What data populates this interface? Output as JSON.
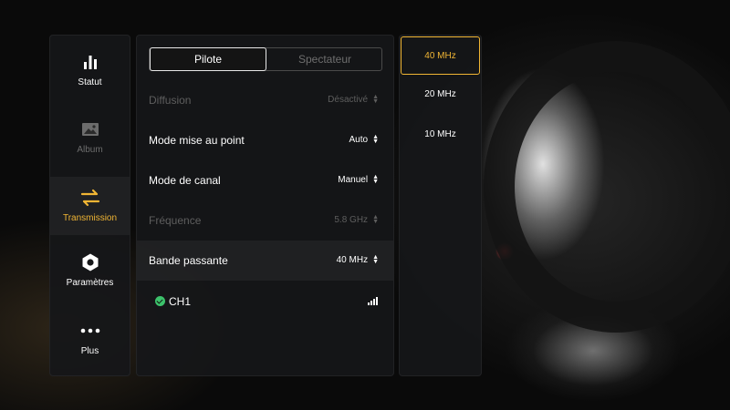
{
  "sidebar": {
    "items": [
      {
        "label": "Statut",
        "icon": "bar-chart-icon",
        "state": "normal"
      },
      {
        "label": "Album",
        "icon": "image-icon",
        "state": "disabled"
      },
      {
        "label": "Transmission",
        "icon": "transfer-arrows-icon",
        "state": "active"
      },
      {
        "label": "Paramètres",
        "icon": "hexagon-settings-icon",
        "state": "normal"
      },
      {
        "label": "Plus",
        "icon": "more-dots-icon",
        "state": "normal"
      }
    ]
  },
  "main": {
    "tabs": [
      {
        "label": "Pilote",
        "selected": true
      },
      {
        "label": "Spectateur",
        "selected": false
      }
    ],
    "rows": [
      {
        "label": "Diffusion",
        "value": "Désactivé",
        "enabled": false
      },
      {
        "label": "Mode mise au point",
        "value": "Auto",
        "enabled": true
      },
      {
        "label": "Mode de canal",
        "value": "Manuel",
        "enabled": true
      },
      {
        "label": "Fréquence",
        "value": "5.8 GHz",
        "enabled": false
      },
      {
        "label": "Bande passante",
        "value": "40 MHz",
        "enabled": true,
        "highlighted": true
      }
    ],
    "channel": {
      "label": "CH1",
      "status_icon": "check-circle-icon",
      "signal_icon": "signal-bars-icon"
    }
  },
  "dropdown": {
    "options": [
      {
        "label": "40 MHz",
        "selected": true
      },
      {
        "label": "20 MHz",
        "selected": false
      },
      {
        "label": "10 MHz",
        "selected": false
      }
    ]
  },
  "colors": {
    "accent": "#f0b534",
    "success": "#3cc26b",
    "panel": "#161719"
  }
}
